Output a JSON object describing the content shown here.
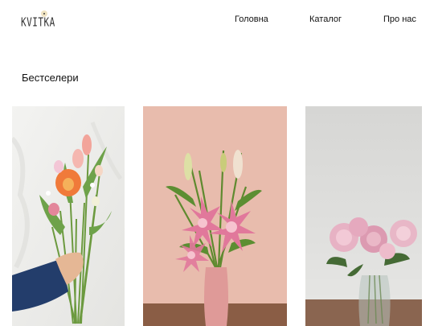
{
  "header": {
    "logo_text": "KVITKA",
    "nav": {
      "home": "Головна",
      "catalog": "Каталог",
      "about": "Про нас"
    }
  },
  "bestsellers": {
    "title": "Бестселери",
    "products": [
      {
        "image": "hand-holding-bouquet-tulips-carnations"
      },
      {
        "image": "pink-lilies-in-pink-vase"
      },
      {
        "image": "pink-peonies-in-glass-vase"
      }
    ]
  },
  "colors": {
    "background": "#ffffff",
    "text": "#111111"
  }
}
